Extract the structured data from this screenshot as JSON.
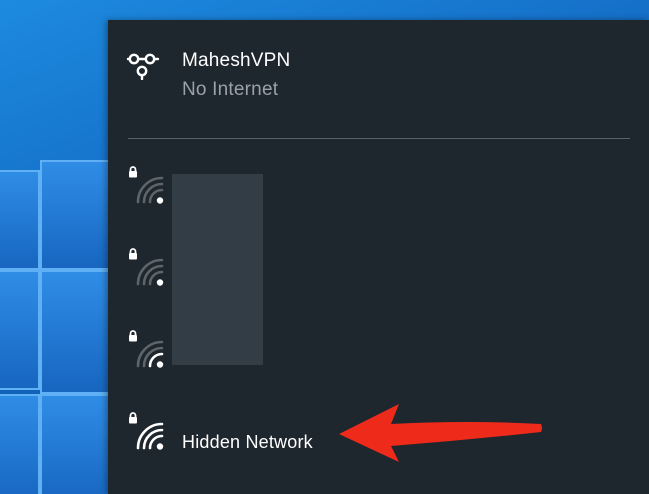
{
  "vpn": {
    "name": "MaheshVPN",
    "status": "No Internet",
    "icon": "vpn-link-icon"
  },
  "networks": [
    {
      "icon": "wifi-secured-weak-icon",
      "label": ""
    },
    {
      "icon": "wifi-secured-weak-icon",
      "label": ""
    },
    {
      "icon": "wifi-secured-fair-icon",
      "label": ""
    },
    {
      "icon": "wifi-secured-good-icon",
      "label": "Hidden Network"
    }
  ],
  "colors": {
    "panel": "#1e262e",
    "status_text": "#9aa1a8",
    "annotation_arrow": "#ee2a1b"
  }
}
